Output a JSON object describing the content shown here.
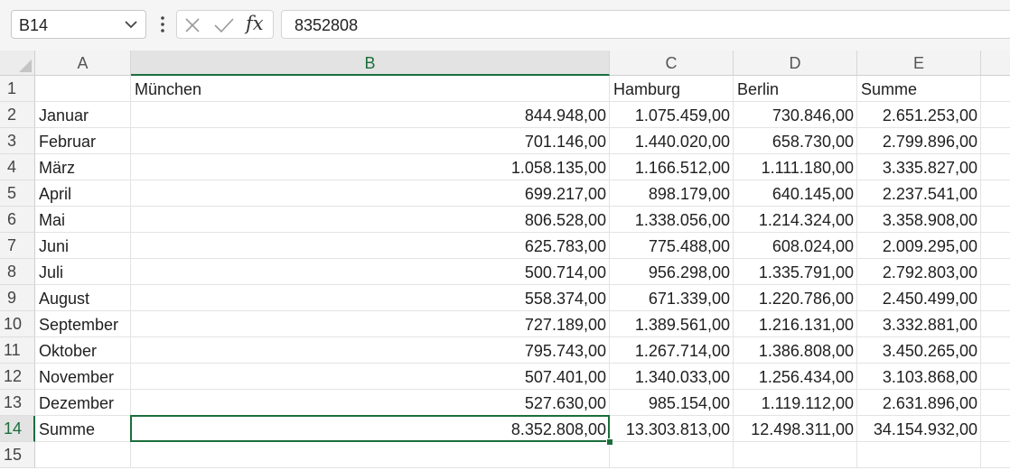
{
  "formula_bar": {
    "name_box": "B14",
    "formula": "8352808",
    "fx_label": "fx"
  },
  "columns": [
    "A",
    "B",
    "C",
    "D",
    "E"
  ],
  "rows": [
    [
      "",
      "München",
      "Hamburg",
      "Berlin",
      "Summe"
    ],
    [
      "Januar",
      "844.948,00",
      "1.075.459,00",
      "730.846,00",
      "2.651.253,00"
    ],
    [
      "Februar",
      "701.146,00",
      "1.440.020,00",
      "658.730,00",
      "2.799.896,00"
    ],
    [
      "März",
      "1.058.135,00",
      "1.166.512,00",
      "1.111.180,00",
      "3.335.827,00"
    ],
    [
      "April",
      "699.217,00",
      "898.179,00",
      "640.145,00",
      "2.237.541,00"
    ],
    [
      "Mai",
      "806.528,00",
      "1.338.056,00",
      "1.214.324,00",
      "3.358.908,00"
    ],
    [
      "Juni",
      "625.783,00",
      "775.488,00",
      "608.024,00",
      "2.009.295,00"
    ],
    [
      "Juli",
      "500.714,00",
      "956.298,00",
      "1.335.791,00",
      "2.792.803,00"
    ],
    [
      "August",
      "558.374,00",
      "671.339,00",
      "1.220.786,00",
      "2.450.499,00"
    ],
    [
      "September",
      "727.189,00",
      "1.389.561,00",
      "1.216.131,00",
      "3.332.881,00"
    ],
    [
      "Oktober",
      "795.743,00",
      "1.267.714,00",
      "1.386.808,00",
      "3.450.265,00"
    ],
    [
      "November",
      "507.401,00",
      "1.340.033,00",
      "1.256.434,00",
      "3.103.868,00"
    ],
    [
      "Dezember",
      "527.630,00",
      "985.154,00",
      "1.119.112,00",
      "2.631.896,00"
    ],
    [
      "Summe",
      "8.352.808,00",
      "13.303.813,00",
      "12.498.311,00",
      "34.154.932,00"
    ],
    [
      "",
      "",
      "",
      "",
      ""
    ]
  ],
  "row_numbers": [
    "1",
    "2",
    "3",
    "4",
    "5",
    "6",
    "7",
    "8",
    "9",
    "10",
    "11",
    "12",
    "13",
    "14",
    "15"
  ],
  "selected_cell": "B14",
  "accent_color": "#1b6e3c"
}
